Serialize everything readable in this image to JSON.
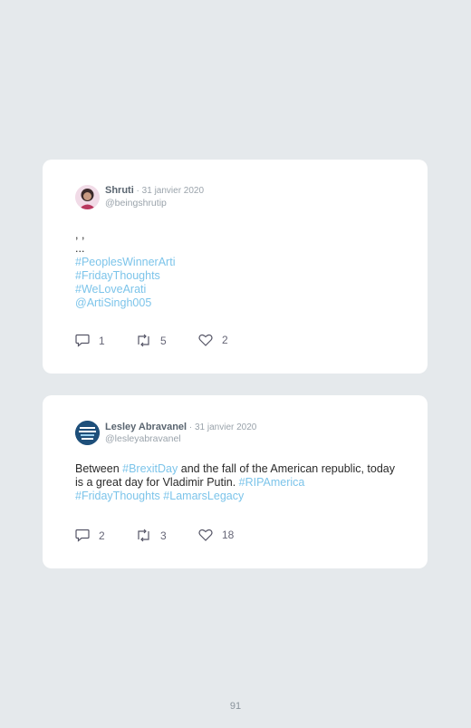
{
  "tweets": [
    {
      "name": "Shruti",
      "date": "31 janvier 2020",
      "handle": "@beingshrutip",
      "text_lines": [
        ", ,",
        "..."
      ],
      "tags": [
        "#PeoplesWinnerArti",
        "#FridayThoughts",
        "#WeLoveArati",
        "@ArtiSingh005"
      ],
      "replies": "1",
      "retweets": "5",
      "likes": "2"
    },
    {
      "name": "Lesley Abravanel",
      "date": "31 janvier 2020",
      "handle": "@lesleyabravanel",
      "text": {
        "part1": "Between ",
        "tag1": "#BrexitDay",
        "part2": " and the fall of the American republic, today is a great day for Vladimir Putin. ",
        "tag2": "#RIPAmerica",
        "tag3": "#FridayThoughts",
        "tag4": "#LamarsLegacy"
      },
      "replies": "2",
      "retweets": "3",
      "likes": "18"
    }
  ],
  "page_number": "91",
  "colors": {
    "background": "#e5e9ec",
    "hashtag": "#7cc4ea",
    "name": "#5a6570",
    "meta": "#9aa3ab"
  },
  "icons": [
    "reply-icon",
    "retweet-icon",
    "like-icon"
  ]
}
